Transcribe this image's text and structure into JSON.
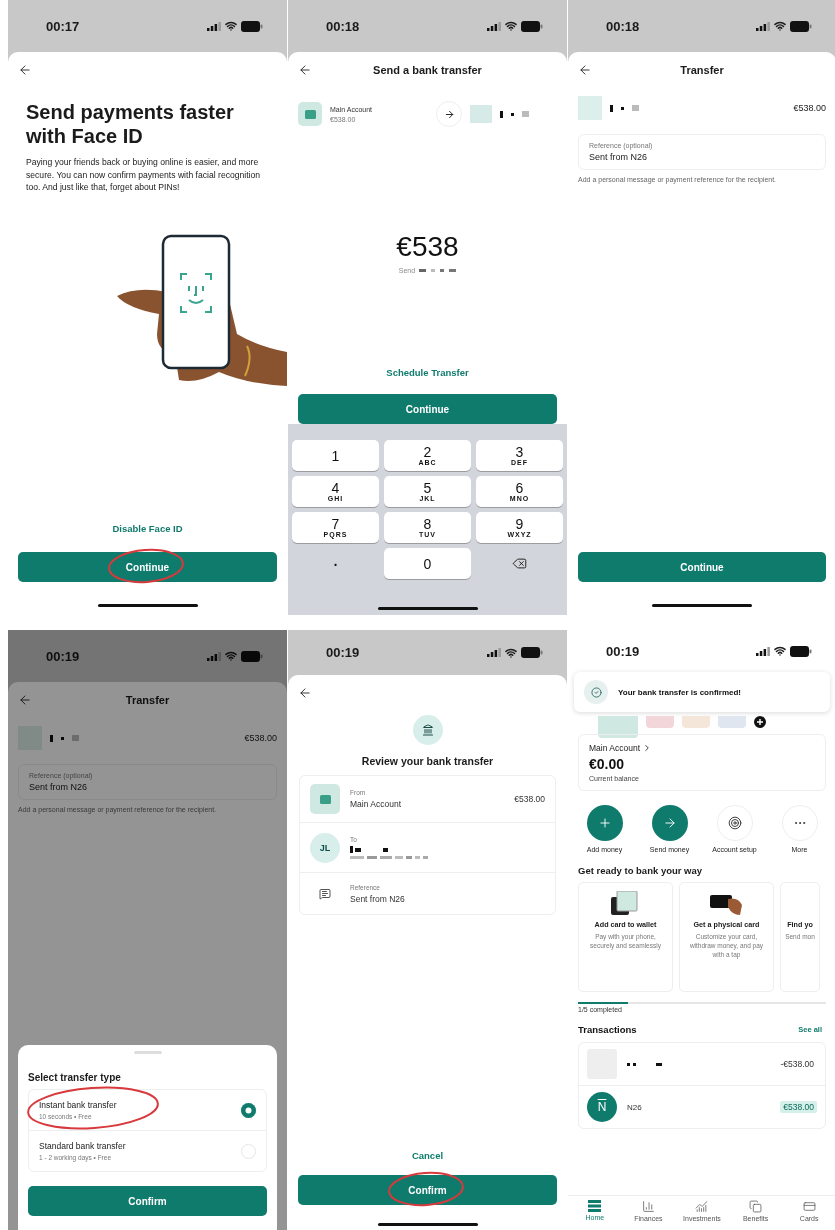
{
  "screens": [
    {
      "kind": "face_id",
      "time": "00:17",
      "title": "Send payments faster with Face ID",
      "body": "Paying your friends back or buying online is easier, and more secure. You can now confirm payments with facial recognition too. And just like that, forget about PINs!",
      "link": "Disable Face ID",
      "button": {
        "label": "Continue",
        "circled": true
      }
    },
    {
      "kind": "amount",
      "time": "00:18",
      "title": "Send a bank transfer",
      "from": {
        "name": "Main Account",
        "balance": "€538.00"
      },
      "amount": "€538",
      "send_label": "Send",
      "link": "Schedule Transfer",
      "button": {
        "label": "Continue",
        "circled": false
      },
      "keys": [
        {
          "kind": "digit",
          "digit": "1"
        },
        {
          "kind": "digit",
          "digit": "2",
          "letters": "ABC"
        },
        {
          "kind": "digit",
          "digit": "3",
          "letters": "DEF"
        },
        {
          "kind": "digit",
          "digit": "4",
          "letters": "GHI"
        },
        {
          "kind": "digit",
          "digit": "5",
          "letters": "JKL"
        },
        {
          "kind": "digit",
          "digit": "6",
          "letters": "MNO"
        },
        {
          "kind": "digit",
          "digit": "7",
          "letters": "PQRS"
        },
        {
          "kind": "digit",
          "digit": "8",
          "letters": "TUV"
        },
        {
          "kind": "digit",
          "digit": "9",
          "letters": "WXYZ"
        },
        {
          "kind": "plain",
          "digit": "."
        },
        {
          "kind": "digit",
          "digit": "0"
        },
        {
          "kind": "backspace"
        }
      ]
    },
    {
      "kind": "reference",
      "time": "00:18",
      "title": "Transfer",
      "amount": "€538.00",
      "field": {
        "label": "Reference (optional)",
        "value": "Sent from N26"
      },
      "hint": "Add a personal message or payment reference for the recipient.",
      "button": {
        "label": "Continue",
        "circled": false
      }
    },
    {
      "kind": "transfer_type",
      "time": "00:19",
      "title": "Transfer",
      "amount": "€538.00",
      "field": {
        "label": "Reference (optional)",
        "value": "Sent from N26"
      },
      "hint": "Add a personal message or payment reference for the recipient.",
      "sheet": {
        "title": "Select transfer type",
        "options": [
          {
            "name": "Instant bank transfer",
            "detail": "10 seconds • Free",
            "selected": true,
            "circled": true
          },
          {
            "name": "Standard bank transfer",
            "detail": "1 - 2 working days • Free",
            "selected": false,
            "circled": false
          }
        ],
        "button": {
          "label": "Confirm",
          "circled": false
        }
      }
    },
    {
      "kind": "review",
      "time": "00:19",
      "title": "Review your bank transfer",
      "rows": [
        {
          "kind": "from",
          "label": "From",
          "value": "Main Account",
          "amount": "€538.00"
        },
        {
          "kind": "to",
          "label": "To",
          "initials": "JL"
        },
        {
          "kind": "reference",
          "label": "Reference",
          "value": "Sent from N26"
        }
      ],
      "cancel": "Cancel",
      "button": {
        "label": "Confirm",
        "circled": true
      }
    },
    {
      "kind": "home",
      "time": "00:19",
      "toast": "Your bank transfer is confirmed!",
      "account": {
        "name": "Main Account",
        "balance": "€0.00",
        "caption": "Current balance"
      },
      "actions": [
        {
          "kind": "add",
          "label": "Add money",
          "filled": true
        },
        {
          "kind": "send",
          "label": "Send money",
          "filled": true
        },
        {
          "kind": "target",
          "label": "Account setup",
          "filled": false
        },
        {
          "kind": "more",
          "label": "More",
          "filled": false
        }
      ],
      "section": "Get ready to bank your way",
      "cards": [
        {
          "kind": "wallet",
          "title": "Add card to wallet",
          "text": "Pay with your phone, securely and seamlessly"
        },
        {
          "kind": "card",
          "title": "Get a physical card",
          "text": "Customize your card, withdraw money, and pay with a tap"
        },
        {
          "kind": "none",
          "title": "Find yo",
          "text": "Send mon"
        }
      ],
      "progress": {
        "level": 0.2,
        "label": "1/5 completed"
      },
      "transactions_title": "Transactions",
      "see_all": "See all",
      "transactions": [
        {
          "kind": "redacted",
          "amount": "-€538.00",
          "highlighted": false
        },
        {
          "kind": "n26",
          "logo": "N",
          "name": "N26",
          "amount": "€538.00",
          "highlighted": true
        }
      ],
      "nav": [
        {
          "kind": "home",
          "label": "Home",
          "selected": true
        },
        {
          "kind": "finances",
          "label": "Finances",
          "selected": false
        },
        {
          "kind": "investments",
          "label": "Investments",
          "selected": false
        },
        {
          "kind": "benefits",
          "label": "Benefits",
          "selected": false
        },
        {
          "kind": "cards",
          "label": "Cards",
          "selected": false
        }
      ]
    }
  ]
}
